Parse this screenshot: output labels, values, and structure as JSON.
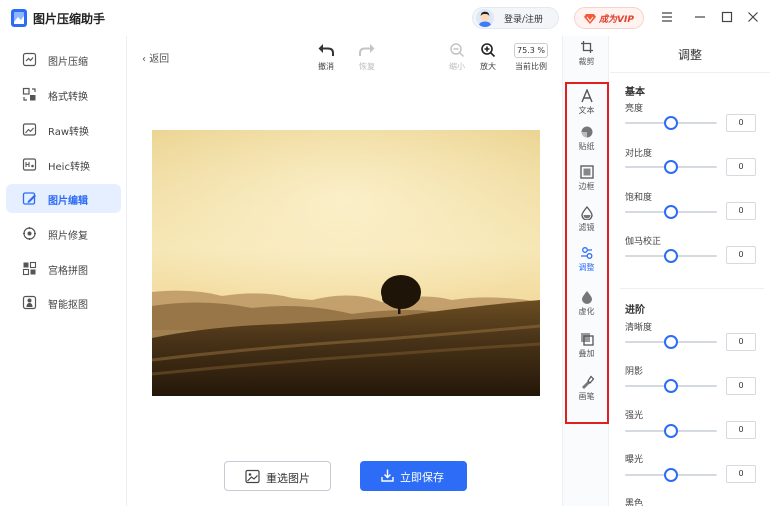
{
  "app": {
    "title": "图片压缩助手"
  },
  "titlebar": {
    "login_text": "登录/注册",
    "vip_text": "成为VIP"
  },
  "colors": {
    "accent": "#2d6cf6",
    "vip": "#e0412f",
    "highlight_frame": "#e02020"
  },
  "sidebar": {
    "items": [
      {
        "label": "图片压缩",
        "icon": "compress-icon",
        "active": false
      },
      {
        "label": "格式转换",
        "icon": "format-convert-icon",
        "active": false
      },
      {
        "label": "Raw转换",
        "icon": "raw-image-icon",
        "active": false
      },
      {
        "label": "Heic转换",
        "icon": "heic-image-icon",
        "active": false
      },
      {
        "label": "图片编辑",
        "icon": "edit-image-icon",
        "active": true
      },
      {
        "label": "照片修复",
        "icon": "photo-repair-icon",
        "active": false
      },
      {
        "label": "宫格拼图",
        "icon": "grid-collage-icon",
        "active": false
      },
      {
        "label": "智能抠图",
        "icon": "smart-cutout-icon",
        "active": false
      }
    ]
  },
  "toolbar": {
    "back_label": "返回",
    "undo_label": "撤消",
    "redo_label": "恢复",
    "zoom_out_label": "缩小",
    "zoom_in_label": "放大",
    "zoom_value": "75.3 %",
    "current_ratio_label": "当前比例"
  },
  "actions": {
    "reselect_label": "重选图片",
    "save_label": "立即保存"
  },
  "vtools": {
    "items": [
      {
        "label": "裁剪",
        "icon": "crop-icon",
        "active": false
      },
      {
        "label": "文本",
        "icon": "text-icon",
        "active": false
      },
      {
        "label": "贴纸",
        "icon": "sticker-icon",
        "active": false
      },
      {
        "label": "边框",
        "icon": "border-frame-icon",
        "active": false
      },
      {
        "label": "滤镜",
        "icon": "filter-drop-icon",
        "active": false
      },
      {
        "label": "调整",
        "icon": "adjust-icon",
        "active": true
      },
      {
        "label": "虚化",
        "icon": "blur-drop-icon",
        "active": false
      },
      {
        "label": "叠加",
        "icon": "overlay-icon",
        "active": false
      },
      {
        "label": "画笔",
        "icon": "brush-icon",
        "active": false
      }
    ]
  },
  "panel": {
    "title": "调整",
    "sections": [
      {
        "title": "基本"
      },
      {
        "title": "进阶"
      }
    ],
    "rows": [
      {
        "label": "亮度",
        "value": "0",
        "level": 0.5
      },
      {
        "label": "对比度",
        "value": "0",
        "level": 0.5
      },
      {
        "label": "饱和度",
        "value": "0",
        "level": 0.5
      },
      {
        "label": "伽马校正",
        "value": "0",
        "level": 0.5
      },
      {
        "label": "清晰度",
        "value": "0",
        "level": 0.5
      },
      {
        "label": "阴影",
        "value": "0",
        "level": 0.5
      },
      {
        "label": "强光",
        "value": "0",
        "level": 0.5
      },
      {
        "label": "曝光",
        "value": "0",
        "level": 0.5
      },
      {
        "label": "黑色",
        "value": "",
        "level": 0.5
      }
    ]
  }
}
